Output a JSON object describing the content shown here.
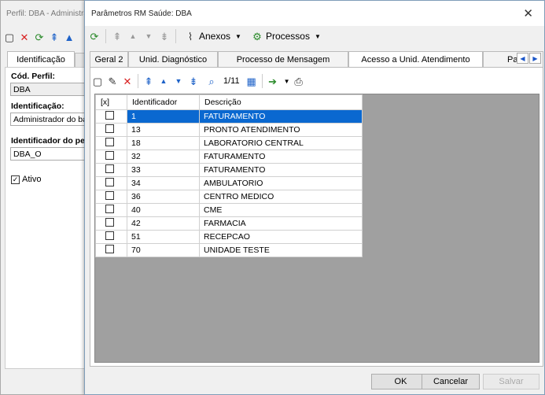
{
  "bg_window": {
    "title": "Perfil: DBA - Administra",
    "tab": "Identificação",
    "fields": [
      {
        "label": "Cód. Perfil:",
        "value": "DBA"
      },
      {
        "label": "Identificação:",
        "value": "Administrador do banc"
      },
      {
        "label": "Identificador do perfi",
        "value": "DBA_O"
      }
    ],
    "ativo_label": "Ativo",
    "ativo_checked": true
  },
  "dialog": {
    "title": "Parâmetros RM Saúde: DBA",
    "close_icon": "✕",
    "menu": {
      "anexos": "Anexos",
      "processos": "Processos"
    },
    "tabs": [
      "Geral 2",
      "Unid. Diagnóstico",
      "Processo de Mensagem",
      "Acesso a Unid. Atendimento",
      "Pa"
    ],
    "active_tab": 3,
    "record_counter": "1/11",
    "grid": {
      "columns": [
        "[x]",
        "Identificador",
        "Descrição"
      ],
      "rows": [
        {
          "id": "1",
          "desc": "FATURAMENTO",
          "selected": true
        },
        {
          "id": "13",
          "desc": "PRONTO ATENDIMENTO"
        },
        {
          "id": "18",
          "desc": "LABORATORIO CENTRAL"
        },
        {
          "id": "32",
          "desc": "FATURAMENTO"
        },
        {
          "id": "33",
          "desc": "FATURAMENTO"
        },
        {
          "id": "34",
          "desc": "AMBULATORIO"
        },
        {
          "id": "36",
          "desc": "CENTRO MEDICO"
        },
        {
          "id": "40",
          "desc": "CME"
        },
        {
          "id": "42",
          "desc": "FARMACIA"
        },
        {
          "id": "51",
          "desc": "RECEPCAO"
        },
        {
          "id": "70",
          "desc": "UNIDADE TESTE"
        }
      ]
    },
    "buttons": {
      "ok": "OK",
      "cancel": "Cancelar",
      "save": "Salvar"
    },
    "colors": {
      "selection": "#0a68d0",
      "grid_bg": "#a0a0a0"
    }
  }
}
